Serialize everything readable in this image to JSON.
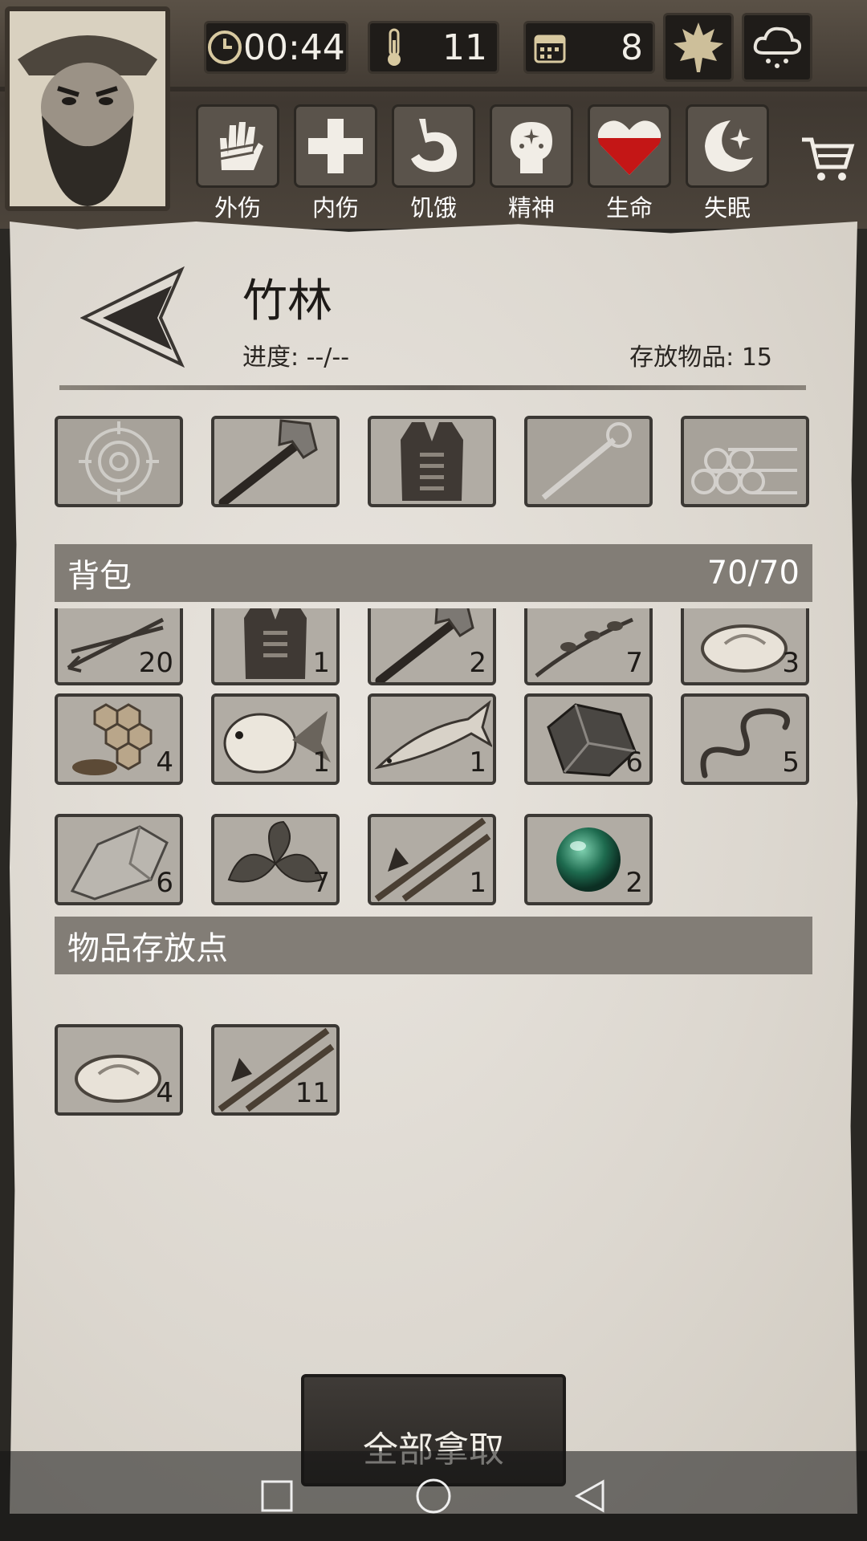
{
  "hud": {
    "time": "00:44",
    "temperature": "11",
    "day": "8",
    "season_icon": "maple-leaf-icon",
    "weather_icon": "rain-cloud-icon"
  },
  "status_bar": [
    {
      "label": "外伤",
      "icon": "bandaged-hand-icon"
    },
    {
      "label": "内伤",
      "icon": "cross-icon"
    },
    {
      "label": "饥饿",
      "icon": "stomach-icon"
    },
    {
      "label": "精神",
      "icon": "head-sparkle-icon"
    },
    {
      "label": "生命",
      "icon": "heart-icon",
      "color": "#c41616"
    },
    {
      "label": "失眠",
      "icon": "moon-star-icon"
    }
  ],
  "location": {
    "title": "竹林",
    "progress": "进度: --/--",
    "stored": "存放物品: 15"
  },
  "equipment": [
    {
      "icon": "target-icon",
      "empty": true
    },
    {
      "icon": "axe-icon"
    },
    {
      "icon": "leather-vest-icon"
    },
    {
      "icon": "torch-icon",
      "empty": true
    },
    {
      "icon": "log-pile-icon",
      "empty": true
    }
  ],
  "backpack": {
    "title": "背包",
    "capacity": "70/70",
    "items": [
      {
        "icon": "arrows-icon",
        "count": "20"
      },
      {
        "icon": "leather-vest-icon",
        "count": "1"
      },
      {
        "icon": "axe-icon",
        "count": "2"
      },
      {
        "icon": "herb-branch-icon",
        "count": "7"
      },
      {
        "icon": "raw-meat-icon",
        "count": "3"
      },
      {
        "icon": "honeycomb-icon",
        "count": "4"
      },
      {
        "icon": "pufferfish-icon",
        "count": "1"
      },
      {
        "icon": "salmon-icon",
        "count": "1"
      },
      {
        "icon": "flint-stone-icon",
        "count": "6"
      },
      {
        "icon": "worm-icon",
        "count": "5"
      },
      {
        "icon": "stone-icon",
        "count": "6"
      },
      {
        "icon": "leaves-icon",
        "count": "7"
      },
      {
        "icon": "bamboo-spear-icon",
        "count": "1"
      },
      {
        "icon": "green-orb-icon",
        "count": "2"
      }
    ]
  },
  "storage": {
    "title": "物品存放点",
    "items": [
      {
        "icon": "raw-meat-icon",
        "count": "4"
      },
      {
        "icon": "bamboo-spear-icon",
        "count": "11"
      }
    ]
  },
  "take_all_label": "全部拿取"
}
